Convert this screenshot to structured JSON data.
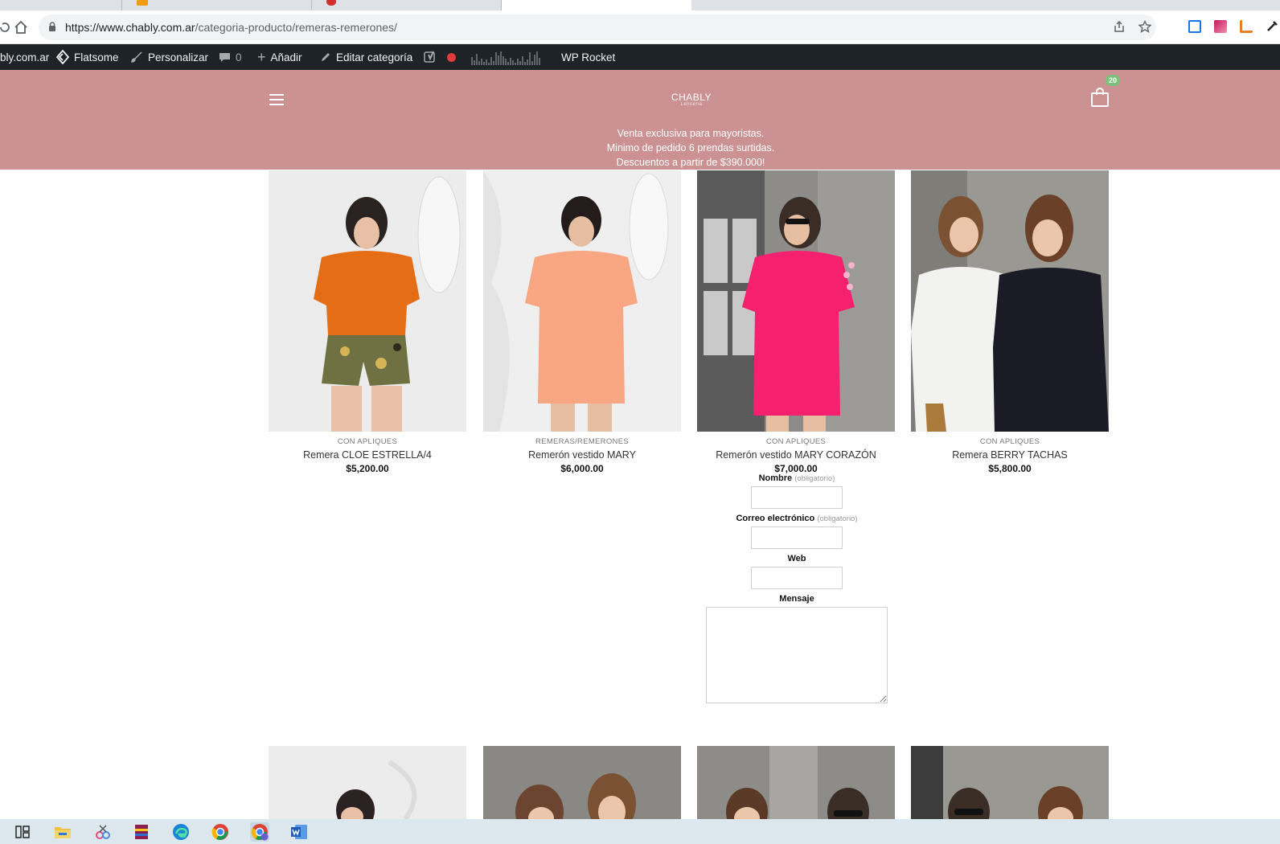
{
  "browser": {
    "url_host": "https://www.chably.com.ar",
    "url_path": "/categoria-producto/remeras-remerones/"
  },
  "wp_admin_bar": {
    "site": "bly.com.ar",
    "flatsome": "Flatsome",
    "customize": "Personalizar",
    "comments_count": "0",
    "add_new": "Añadir",
    "edit_category": "Editar categoría",
    "wp_rocket": "WP Rocket"
  },
  "header": {
    "logo": "CHABLY",
    "logo_sub": "Lenceria",
    "cart_count": "20",
    "promo_lines": [
      "Venta exclusiva para mayoristas.",
      "Minimo de pedido 6 prendas surtidas.",
      "Descuentos a partir de $390.000!"
    ]
  },
  "products": [
    {
      "category": "CON APLIQUES",
      "name": "Remera CLOE ESTRELLA/4",
      "price": "$5,200.00"
    },
    {
      "category": "REMERAS/REMERONES",
      "name": "Remerón vestido MARY",
      "price": "$6,000.00"
    },
    {
      "category": "CON APLIQUES",
      "name": "Remerón vestido MARY CORAZÓN",
      "price": "$7,000.00"
    },
    {
      "category": "CON APLIQUES",
      "name": "Remera BERRY TACHAS",
      "price": "$5,800.00"
    }
  ],
  "form": {
    "name_label": "Nombre",
    "required": "(obligatorio)",
    "email_label": "Correo electrónico",
    "web_label": "Web",
    "message_label": "Mensaje"
  },
  "colors": {
    "header_bg": "#cc9192",
    "admin_bar": "#1d2327",
    "cart_badge": "#7ac27a"
  }
}
